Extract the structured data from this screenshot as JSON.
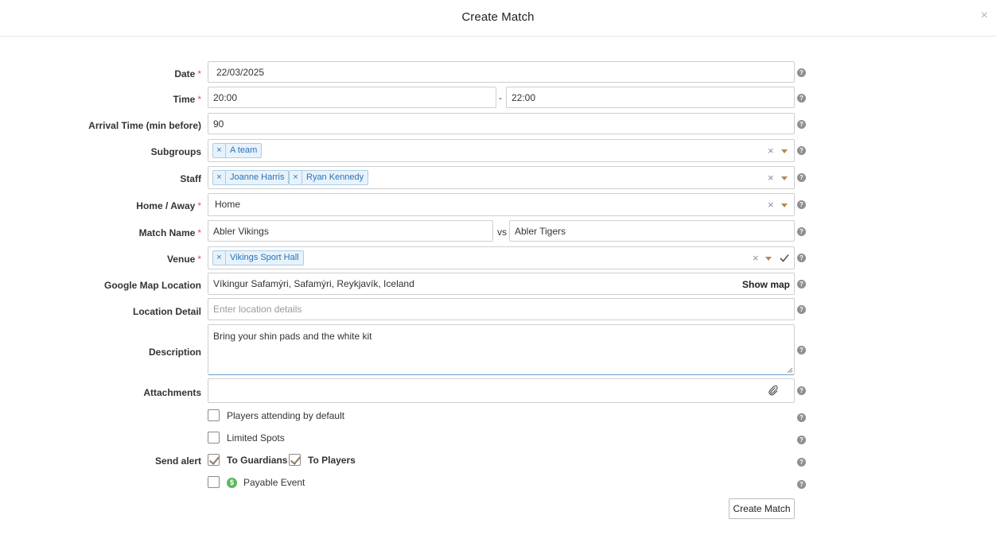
{
  "modal": {
    "title": "Create Match",
    "close": "×"
  },
  "form": {
    "date": {
      "label": "Date",
      "required": "*",
      "value": "22/03/2025"
    },
    "time": {
      "label": "Time",
      "required": "*",
      "start": "20:00",
      "separator": "-",
      "end": "22:00"
    },
    "arrival": {
      "label": "Arrival Time (min before)",
      "value": "90"
    },
    "subgroups": {
      "label": "Subgroups",
      "chips": [
        "A team"
      ]
    },
    "staff": {
      "label": "Staff",
      "chips": [
        "Joanne Harris",
        "Ryan Kennedy"
      ]
    },
    "home_away": {
      "label": "Home / Away",
      "required": "*",
      "value": "Home"
    },
    "match_name": {
      "label": "Match Name",
      "required": "*",
      "home": "Abler Vikings",
      "vs": "vs",
      "away": "Abler Tigers"
    },
    "venue": {
      "label": "Venue",
      "required": "*",
      "chips": [
        "Vikings Sport Hall"
      ]
    },
    "google_map": {
      "label": "Google Map Location",
      "value": "Víkingur Safamýri, Safamýri, Reykjavík, Iceland",
      "show_map": "Show map"
    },
    "location_detail": {
      "label": "Location Detail",
      "placeholder": "Enter location details"
    },
    "description": {
      "label": "Description",
      "value": "Bring your shin pads and the white kit"
    },
    "attachments": {
      "label": "Attachments"
    },
    "players_attending": {
      "label": "Players attending by default",
      "checked": false
    },
    "limited_spots": {
      "label": "Limited Spots",
      "checked": false
    },
    "send_alert": {
      "label": "Send alert",
      "guardians": "To Guardians",
      "guardians_checked": true,
      "players": "To Players",
      "players_checked": true
    },
    "payable": {
      "label": "Payable Event",
      "checked": false,
      "icon": "dollar-icon",
      "icon_glyph": "$"
    }
  },
  "actions": {
    "submit": "Create Match"
  },
  "icons": {
    "help": "?",
    "clear": "×",
    "chip_remove": "×"
  },
  "colors": {
    "chip_bg": "#e8f2fb",
    "chip_text": "#2a72b5",
    "caret": "#b3884a",
    "required": "#d9534f",
    "payable": "#5cb85c"
  }
}
